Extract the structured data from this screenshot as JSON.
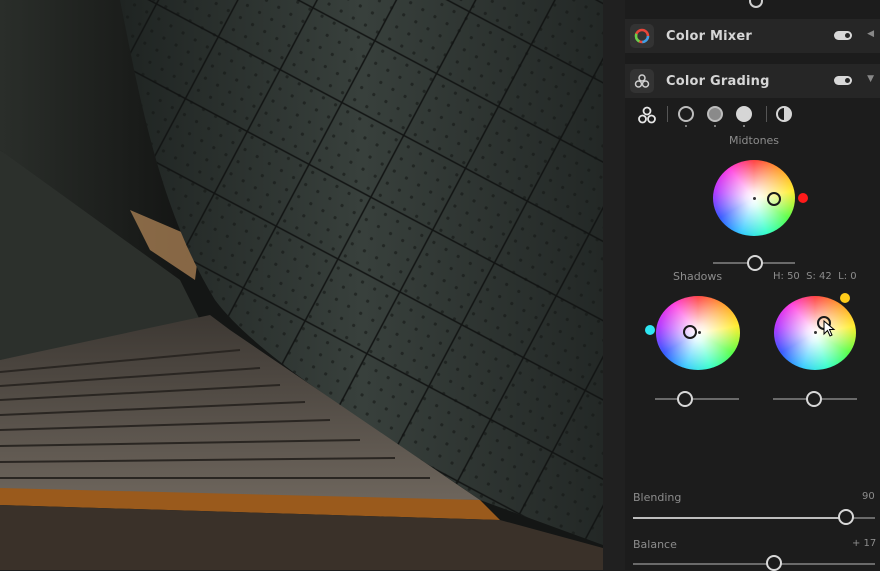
{
  "panel": {
    "color_mixer": {
      "title": "Color Mixer",
      "enabled": true
    },
    "color_grading": {
      "title": "Color Grading",
      "enabled": true,
      "modes": [
        "three-way-icon",
        "shadows-circle-icon",
        "midtones-circle-icon",
        "highlights-circle-icon",
        "global-half-circle-icon"
      ],
      "midtones_label": "Midtones",
      "shadows_label": "Shadows",
      "readout": "H: 50  S: 42  L: 0",
      "blending_label": "Blending",
      "blending_value": "90",
      "balance_label": "Balance",
      "balance_value": "+ 17",
      "colors": {
        "midtones_indicator": "#ff1a1a",
        "shadows_indicator": "#2ee6f2",
        "highlights_indicator": "#ffcc1a"
      }
    }
  }
}
